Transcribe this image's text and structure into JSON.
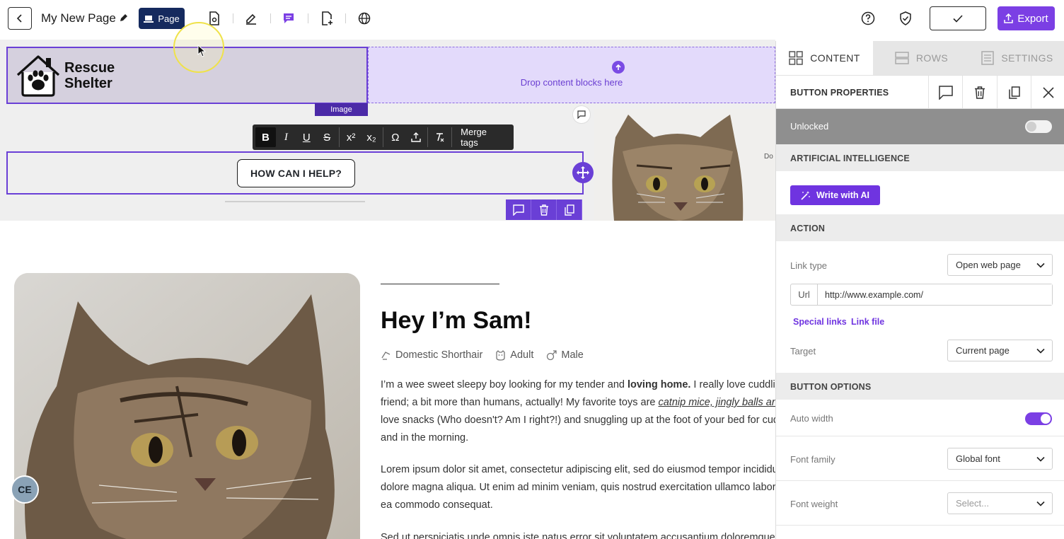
{
  "header": {
    "title": "My New Page",
    "page_button": "Page",
    "export_label": "Export"
  },
  "canvas": {
    "logo_block": {
      "line1": "Rescue",
      "line2": "Shelter",
      "tag": "Image"
    },
    "drop_zone_text": "Drop content blocks here",
    "side_label": "Do",
    "format_toolbar": {
      "buttons": [
        "B",
        "I",
        "U",
        "S",
        "x²",
        "x₂",
        "Ω"
      ],
      "merge_tags": "Merge tags"
    },
    "help_button": "HOW CAN I HELP?",
    "profile": {
      "heading": "Hey I’m Sam!",
      "breed": "Domestic Shorthair",
      "age": "Adult",
      "sex": "Male",
      "para1_lines": [
        "I’m a wee sweet sleepy boy looking for my tender and ",
        "loving home.",
        " I really love cuddling",
        "friend; a bit more than humans, actually! My favorite toys are ",
        "catnip mice, jingly balls and",
        "love snacks (Who doesn't? Am I right?!) and snuggling up at the foot of your bed for cudo",
        "and in the morning."
      ],
      "para2_lines": [
        "Lorem ipsum dolor sit amet, consectetur adipiscing elit, sed do eiusmod tempor incididur",
        "dolore magna aliqua. Ut enim ad minim veniam, quis nostrud exercitation ullamco laboris",
        "ea commodo consequat."
      ],
      "para3_line": "Sed ut perspiciatis unde omnis iste natus error sit voluptatem accusantium doloremque la"
    },
    "avatar_initials": "CE"
  },
  "panel": {
    "tabs": [
      {
        "label": "CONTENT",
        "active": true
      },
      {
        "label": "ROWS",
        "active": false
      },
      {
        "label": "SETTINGS",
        "active": false
      }
    ],
    "properties_title": "BUTTON PROPERTIES",
    "lock_label": "Unlocked",
    "lock_on": false,
    "sections": {
      "ai": "ARTIFICIAL INTELLIGENCE",
      "action": "ACTION",
      "button_options": "BUTTON OPTIONS"
    },
    "ai_button": "Write with AI",
    "link_type": {
      "label": "Link type",
      "value": "Open web page"
    },
    "url": {
      "prefix": "Url",
      "value": "http://www.example.com/"
    },
    "special_links": "Special links",
    "link_file": "Link file",
    "target": {
      "label": "Target",
      "value": "Current page"
    },
    "auto_width": {
      "label": "Auto width",
      "on": true
    },
    "font_family": {
      "label": "Font family",
      "value": "Global font"
    },
    "font_weight": {
      "label": "Font weight",
      "placeholder": "Select..."
    }
  },
  "colors": {
    "accent": "#7b3fe4",
    "selection": "#6a3fd6",
    "navy": "#152a5e"
  }
}
